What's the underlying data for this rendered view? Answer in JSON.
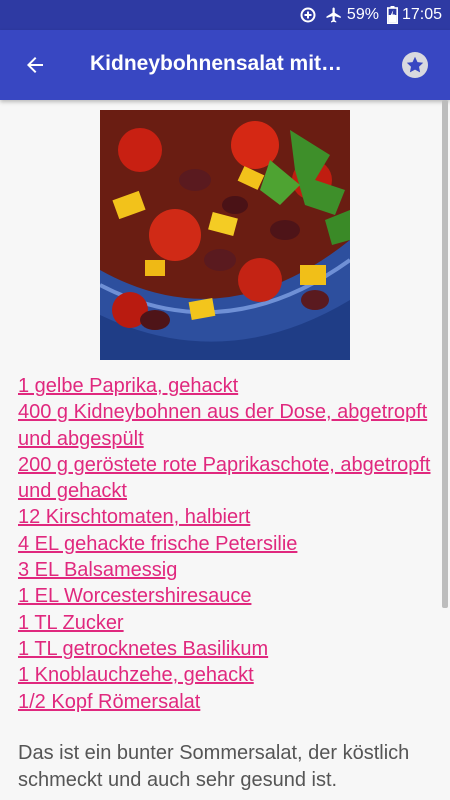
{
  "status_bar": {
    "battery_percent": "59%",
    "time": "17:05",
    "icons": [
      "data-saver-icon",
      "airplane-mode-icon",
      "battery-charging-icon"
    ]
  },
  "app_bar": {
    "title": "Kidneybohnensalat mit…",
    "back_icon": "arrow-back-icon",
    "favorite_icon": "star-icon"
  },
  "colors": {
    "status_bar": "#2e3aa3",
    "app_bar": "#3847c2",
    "link": "#e0287e",
    "text": "#555555",
    "background": "#f7f7f7"
  },
  "recipe": {
    "image_subject": "bean salad with tomatoes, bell peppers and parsley in a blue bowl",
    "ingredients": [
      "1 gelbe Paprika, gehackt",
      "400 g Kidneybohnen aus der Dose, abgetropft und abgespült",
      "200 g geröstete rote Paprikaschote, abgetropft und gehackt",
      "12 Kirschtomaten, halbiert",
      "4 EL gehackte frische Petersilie",
      "3 EL Balsamessig",
      "1 EL Worcestershiresauce",
      "1 TL Zucker",
      "1 TL getrocknetes Basilikum",
      "1 Knoblauchzehe, gehackt",
      "1/2 Kopf Römersalat"
    ],
    "description": "Das ist ein bunter Sommersalat, der köstlich schmeckt und auch sehr gesund ist."
  }
}
